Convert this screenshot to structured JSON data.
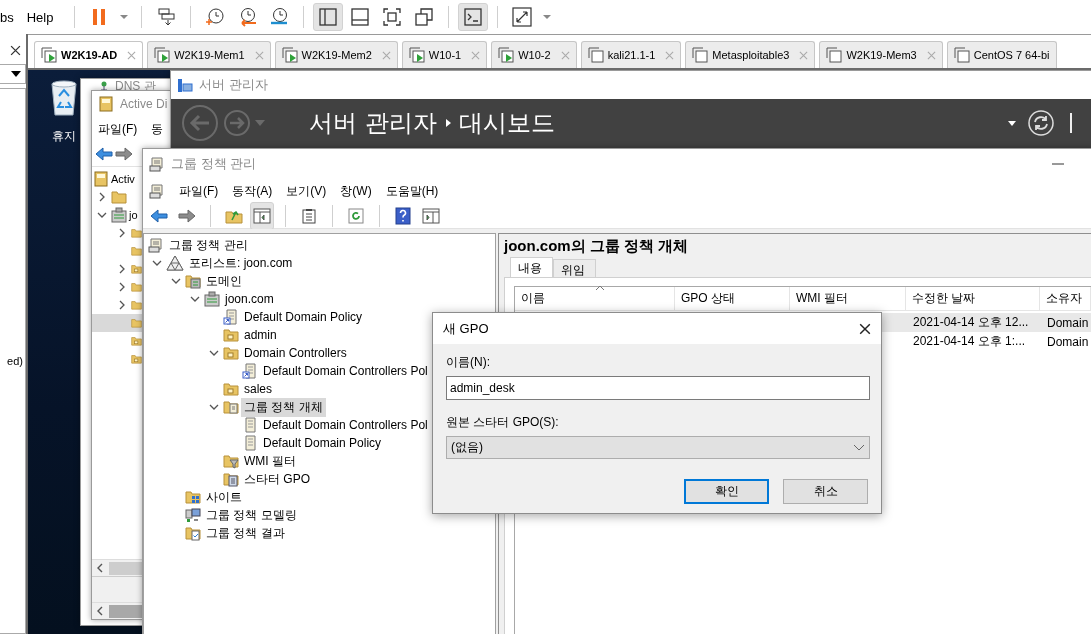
{
  "vmware_menu": [
    {
      "label": "bs"
    },
    {
      "label": "Help"
    }
  ],
  "vmware_toolbar": [
    [
      {
        "kind": "pause",
        "selected": false
      },
      {
        "kind": "dropdown",
        "selected": false
      }
    ],
    [
      {
        "kind": "send-keys",
        "selected": false
      }
    ],
    [
      {
        "kind": "snapshot-take",
        "selected": false
      },
      {
        "kind": "snapshot-revert",
        "selected": false
      },
      {
        "kind": "snapshot-manage",
        "selected": false
      }
    ],
    [
      {
        "kind": "library-view",
        "selected": true
      },
      {
        "kind": "thumbnail-view",
        "selected": false
      },
      {
        "kind": "full-screen",
        "selected": false
      },
      {
        "kind": "unity",
        "selected": false
      }
    ],
    [
      {
        "kind": "console-view",
        "selected": true
      }
    ],
    [
      {
        "kind": "stretch",
        "selected": false
      },
      {
        "kind": "dropdown",
        "selected": false
      }
    ]
  ],
  "side_panel": {
    "list_text": "ed)"
  },
  "vm_tabs": [
    {
      "label": "W2K19-AD",
      "selected": true,
      "running": true
    },
    {
      "label": "W2K19-Mem1",
      "selected": false,
      "running": true
    },
    {
      "label": "W2K19-Mem2",
      "selected": false,
      "running": true
    },
    {
      "label": "W10-1",
      "selected": false,
      "running": true
    },
    {
      "label": "W10-2",
      "selected": false,
      "running": true
    },
    {
      "label": "kali21.1-1",
      "selected": false,
      "running": false
    },
    {
      "label": "Metasploitable3",
      "selected": false,
      "running": false
    },
    {
      "label": "W2K19-Mem3",
      "selected": false,
      "running": false
    },
    {
      "label": "CentOS 7 64-bi",
      "selected": false,
      "running": false
    }
  ],
  "desktop": {
    "recycle_bin": "휴지"
  },
  "dns_window": {
    "title": "DNS 관"
  },
  "ad_window": {
    "title": "Active Di",
    "menu": [
      "파일(F)",
      "동"
    ],
    "tree": [
      {
        "label": "Activ",
        "kind": "root",
        "selected": false,
        "children": [
          {
            "kind": "folder",
            "expanded": false,
            "selected": false
          },
          {
            "label": "jo",
            "kind": "domain",
            "expanded": true,
            "selected": false,
            "children": [
              {
                "kind": "folder",
                "expanded": false,
                "selected": false
              },
              {
                "kind": "folder",
                "selected": false
              },
              {
                "kind": "ou",
                "expanded": false,
                "selected": false
              },
              {
                "kind": "folder",
                "expanded": false,
                "selected": false
              },
              {
                "kind": "folder",
                "expanded": false,
                "selected": false
              },
              {
                "kind": "folder",
                "selected": true
              },
              {
                "kind": "ou",
                "selected": false
              },
              {
                "kind": "ou",
                "selected": false
              }
            ]
          }
        ]
      }
    ]
  },
  "server_manager": {
    "title": "서버 관리자",
    "breadcrumb": [
      "서버 관리자",
      "대시보드"
    ]
  },
  "gpm": {
    "title": "그룹 정책 관리",
    "menu": [
      "파일(F)",
      "동작(A)",
      "보기(V)",
      "창(W)",
      "도움말(H)"
    ],
    "toolbar": [
      [
        {
          "kind": "back",
          "selected": false
        },
        {
          "kind": "forward",
          "selected": false
        }
      ],
      [
        {
          "kind": "up",
          "selected": false
        },
        {
          "kind": "tree-toggle",
          "selected": true
        }
      ],
      [
        {
          "kind": "clipboard",
          "selected": false
        }
      ],
      [
        {
          "kind": "refresh",
          "selected": false
        }
      ],
      [
        {
          "kind": "help",
          "selected": false
        },
        {
          "kind": "action-pane",
          "selected": false
        }
      ]
    ],
    "tree": [
      {
        "label": "그룹 정책 관리",
        "kind": "console",
        "selected": false,
        "children": [
          {
            "label": "포리스트: joon.com",
            "kind": "forest",
            "expanded": true,
            "selected": false,
            "children": [
              {
                "label": "도메인",
                "kind": "domains",
                "expanded": true,
                "selected": false,
                "children": [
                  {
                    "label": "joon.com",
                    "kind": "domain",
                    "expanded": true,
                    "selected": false,
                    "children": [
                      {
                        "label": "Default Domain Policy",
                        "kind": "gpo-link",
                        "selected": false
                      },
                      {
                        "label": "admin",
                        "kind": "ou",
                        "selected": false
                      },
                      {
                        "label": "Domain Controllers",
                        "kind": "ou",
                        "expanded": true,
                        "selected": false,
                        "children": [
                          {
                            "label": "Default Domain Controllers Pol",
                            "kind": "gpo-link",
                            "selected": false
                          }
                        ]
                      },
                      {
                        "label": "sales",
                        "kind": "ou",
                        "selected": false
                      },
                      {
                        "label": "그룹 정책 개체",
                        "kind": "gpo-folder",
                        "expanded": true,
                        "selected": true,
                        "children": [
                          {
                            "label": "Default Domain Controllers Pol",
                            "kind": "gpo",
                            "selected": false
                          },
                          {
                            "label": "Default Domain Policy",
                            "kind": "gpo",
                            "selected": false
                          }
                        ]
                      },
                      {
                        "label": "WMI 필터",
                        "kind": "wmi",
                        "selected": false
                      },
                      {
                        "label": "스타터 GPO",
                        "kind": "starter",
                        "selected": false
                      }
                    ]
                  }
                ]
              },
              {
                "label": "사이트",
                "kind": "sites",
                "selected": false
              },
              {
                "label": "그룹 정책 모델링",
                "kind": "modeling",
                "selected": false
              },
              {
                "label": "그룹 정책 결과",
                "kind": "results",
                "selected": false
              }
            ]
          }
        ]
      }
    ],
    "heading": "joon.com의 그룹 정책 개체",
    "tabs": [
      {
        "label": "내용",
        "selected": true
      },
      {
        "label": "위임",
        "selected": false
      }
    ],
    "table": {
      "columns": [
        {
          "label": "이름",
          "sorted": true
        },
        {
          "label": "GPO 상태",
          "sorted": false
        },
        {
          "label": "WMI 필터",
          "sorted": false
        },
        {
          "label": "수정한 날짜",
          "sorted": false
        },
        {
          "label": "소유자",
          "sorted": false
        }
      ],
      "rows": [
        {
          "modified": "2021-04-14 오후 12...",
          "owner": "Domain",
          "selected": true
        },
        {
          "modified": "2021-04-14 오후 1:...",
          "owner": "Domain",
          "selected": false
        }
      ]
    }
  },
  "new_gpo_dialog": {
    "title": "새 GPO",
    "name_label": "이름(N):",
    "name_value": "admin_desk",
    "starter_label": "원본 스타터 GPO(S):",
    "starter_value": "(없음)",
    "buttons": [
      {
        "label": "확인",
        "default": true
      },
      {
        "label": "취소",
        "default": false
      }
    ]
  }
}
